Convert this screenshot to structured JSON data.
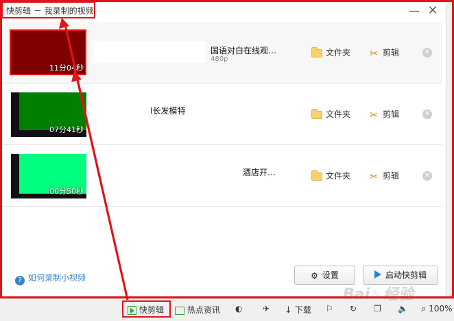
{
  "window": {
    "title": "快剪辑 － 我录制的视频",
    "minimize_icon": "minimize-icon",
    "close_icon": "close-icon"
  },
  "videos": [
    {
      "duration": "11分04秒",
      "name": "国语对白在线观…",
      "resolution": "480p",
      "thumb_color": "#800000",
      "folder_label": "文件夹",
      "edit_label": "剪辑"
    },
    {
      "duration": "07分41秒",
      "name": "I长发模特",
      "thumb_color": "#008000",
      "folder_label": "文件夹",
      "edit_label": "剪辑"
    },
    {
      "duration": "00分50秒",
      "name": "酒店开…",
      "thumb_color": "#00ff7f",
      "folder_label": "文件夹",
      "edit_label": "剪辑"
    }
  ],
  "footer": {
    "help_label": "如何录制小视频",
    "settings_label": "设置",
    "launch_label": "启动快剪辑"
  },
  "taskbar": {
    "items": [
      "快剪辑",
      "热点资讯"
    ],
    "download_label": "下载",
    "zoom": "100%"
  },
  "watermark": "Bai♨经验",
  "colors": {
    "highlight": "#e0141b",
    "accent": "#3a83c7"
  }
}
